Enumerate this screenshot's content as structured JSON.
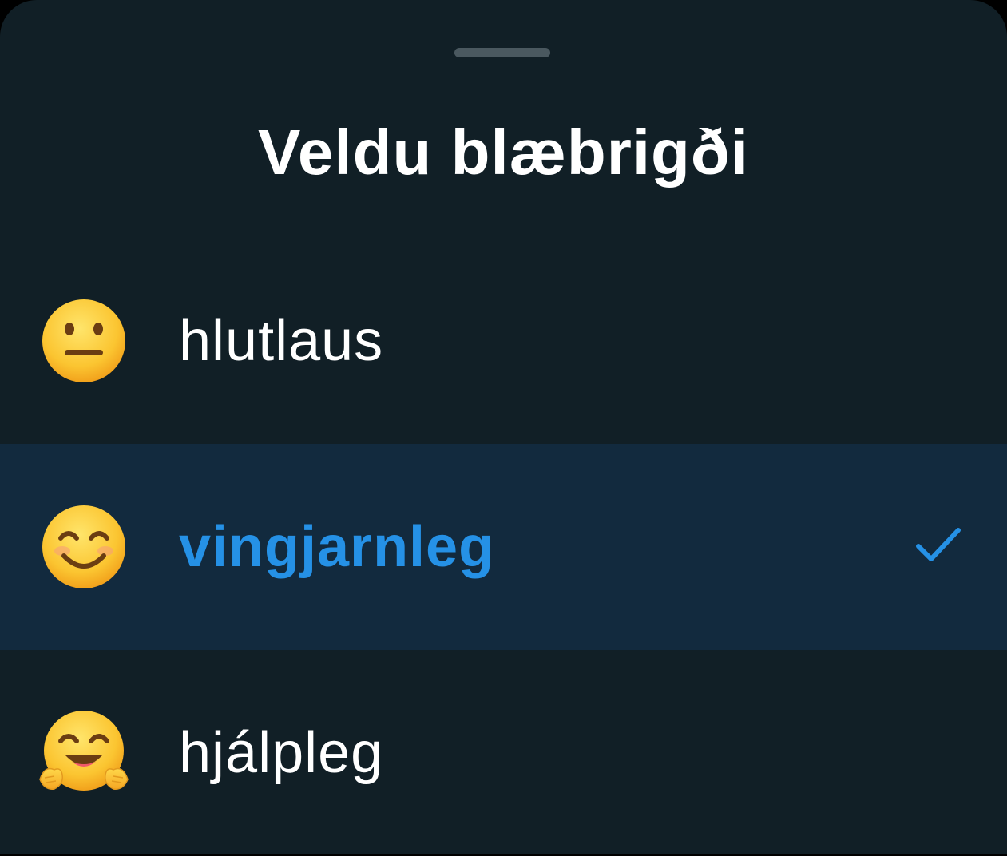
{
  "sheet": {
    "title": "Veldu blæbrigði",
    "options": [
      {
        "label": "hlutlaus",
        "icon": "neutral-face-icon",
        "selected": false
      },
      {
        "label": "vingjarnleg",
        "icon": "smiling-face-icon",
        "selected": true
      },
      {
        "label": "hjálpleg",
        "icon": "hugging-face-icon",
        "selected": false
      }
    ],
    "selected_check_icon": "checkmark-icon"
  },
  "colors": {
    "background": "#111f26",
    "selected_row": "#122a3e",
    "accent": "#2591e6",
    "text": "#ffffff",
    "grabber": "#4a585f"
  }
}
